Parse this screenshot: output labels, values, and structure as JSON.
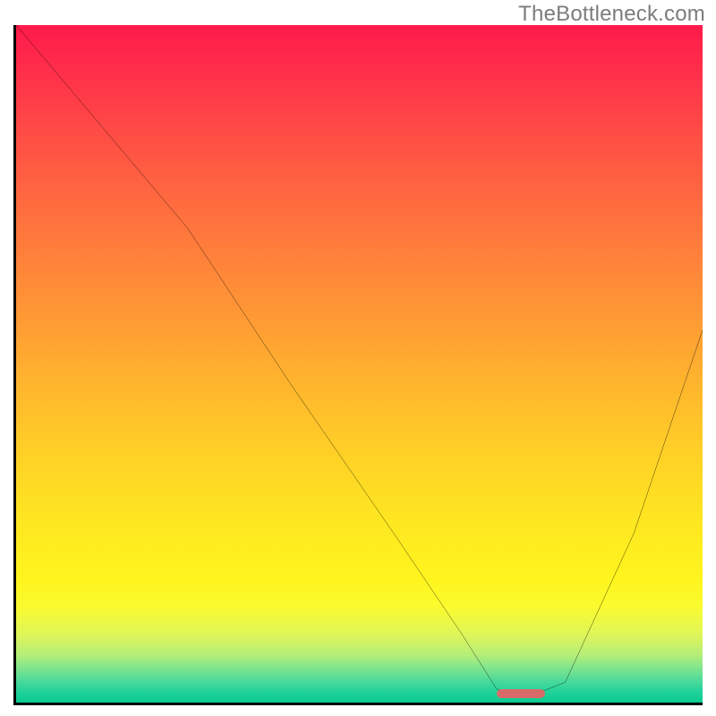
{
  "watermark": "TheBottleneck.com",
  "colors": {
    "gradient_top": "#ff1a4b",
    "gradient_bottom": "#0acb90",
    "curve": "#000000",
    "marker": "#d86b6a",
    "axis": "#000000"
  },
  "chart_data": {
    "type": "line",
    "title": "",
    "xlabel": "",
    "ylabel": "",
    "xlim": [
      0,
      100
    ],
    "ylim": [
      0,
      100
    ],
    "grid": false,
    "legend": false,
    "series": [
      {
        "name": "bottleneck-curve",
        "x": [
          0,
          10,
          25,
          40,
          55,
          65,
          70,
          75,
          80,
          90,
          100
        ],
        "y": [
          100,
          88,
          70,
          47,
          25,
          10,
          2,
          1,
          3,
          25,
          55
        ]
      }
    ],
    "annotations": [
      {
        "name": "optimal-range-marker",
        "x_start": 70,
        "x_end": 77,
        "y": 0.7
      }
    ]
  }
}
